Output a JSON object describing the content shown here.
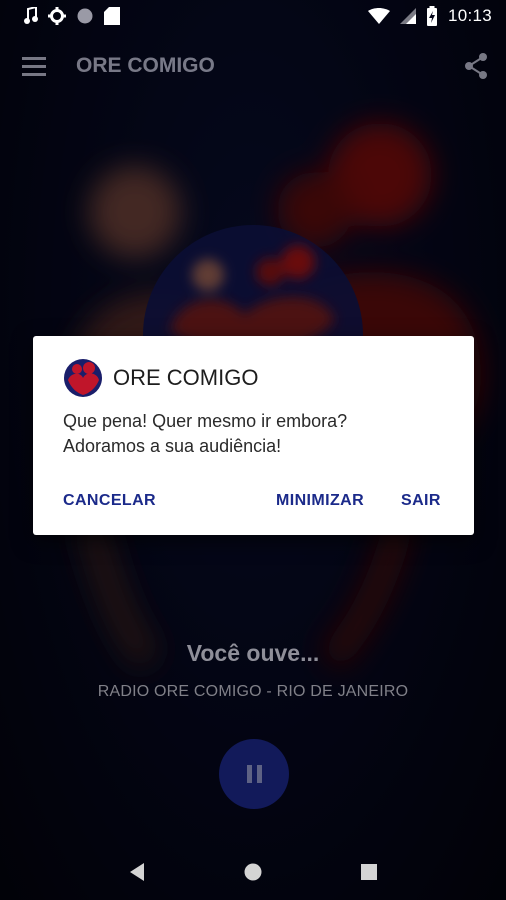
{
  "status_bar": {
    "time": "10:13",
    "left_icons": [
      "music-note-icon",
      "gear-icon",
      "circle-icon",
      "sd-card-icon"
    ],
    "right_icons": [
      "wifi-icon",
      "signal-icon",
      "battery-icon"
    ]
  },
  "toolbar": {
    "title": "ORE COMIGO",
    "menu_icon": "menu-icon",
    "share_icon": "share-icon"
  },
  "player": {
    "now_label": "Você ouve...",
    "station": "RADIO ORE COMIGO - RIO DE JANEIRO",
    "control": "pause-icon"
  },
  "dialog": {
    "title": "ORE COMIGO",
    "message_line1": "Que pena! Quer mesmo ir embora?",
    "message_line2": "Adoramos a sua audiência!",
    "buttons": {
      "cancel": "CANCELAR",
      "minimize": "MINIMIZAR",
      "exit": "SAIR"
    }
  },
  "colors": {
    "accent": "#1b2a8a",
    "logo_red": "#c0152a",
    "logo_blue": "#1a1e6a",
    "play_button": "#121a5a"
  },
  "nav_bar": {
    "icons": [
      "back-icon",
      "home-icon",
      "recents-icon"
    ]
  }
}
